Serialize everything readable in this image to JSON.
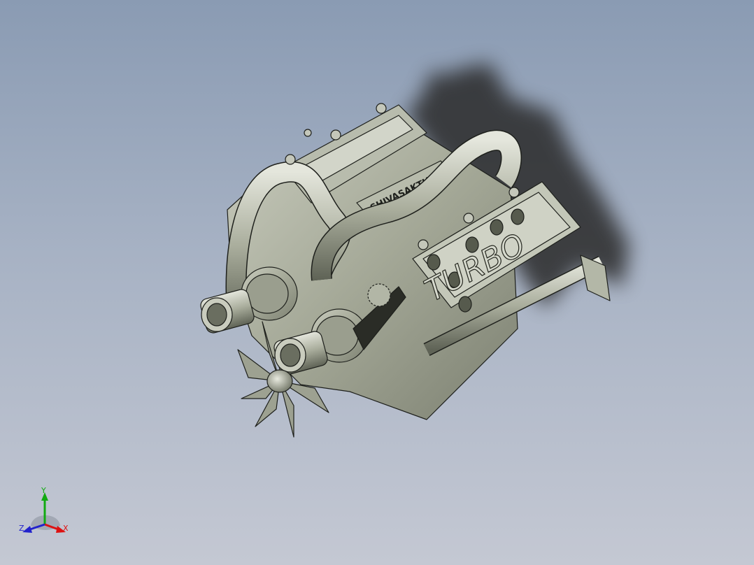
{
  "viewport": {
    "background_top": "#8a9bb3",
    "background_bottom": "#c4c8d3"
  },
  "model": {
    "cover_text": "TURBO",
    "intake_label": "SHIVASAKTHI",
    "part_color": "#a7ab9b",
    "edge_color": "#1e201c"
  },
  "triad": {
    "x_label": "X",
    "y_label": "Y",
    "z_label": "Z",
    "x_color": "#dd1111",
    "y_color": "#11aa11",
    "z_color": "#2222cc"
  }
}
